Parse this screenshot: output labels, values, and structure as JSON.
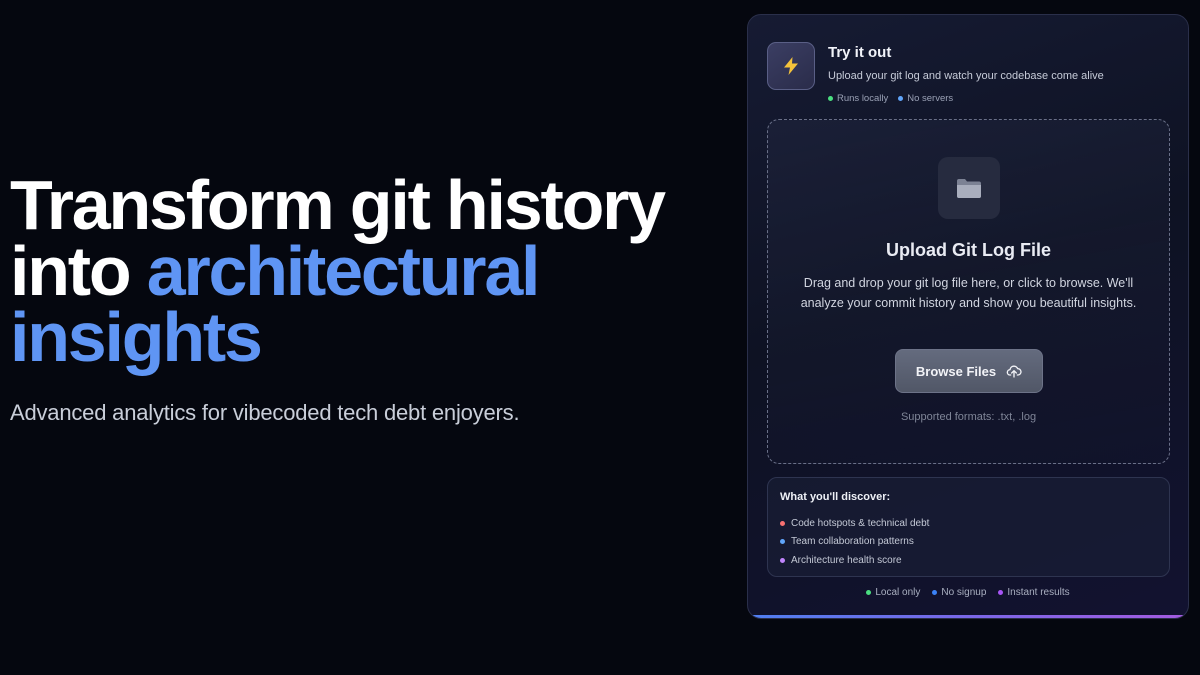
{
  "hero": {
    "title_line1": "Transform git history",
    "title_into": "into ",
    "title_accent_1": "architectural",
    "title_accent_2": "insights",
    "subtitle": "Advanced analytics for vibecoded tech debt enjoyers."
  },
  "card": {
    "icon": "lightning-bolt-icon",
    "title": "Try it out",
    "description": "Upload your git log and watch your codebase come alive",
    "tags": [
      {
        "label": "Runs locally",
        "color": "#4ade80"
      },
      {
        "label": "No servers",
        "color": "#60a5fa"
      }
    ],
    "dropzone": {
      "icon": "folder-icon",
      "title": "Upload Git Log File",
      "description": "Drag and drop your git log file here, or click to browse. We'll analyze your commit history and show you beautiful insights.",
      "button_label": "Browse Files",
      "button_icon": "cloud-upload-icon",
      "formats": "Supported formats: .txt, .log"
    },
    "discover": {
      "title": "What you'll discover:",
      "items": [
        {
          "label": "Code hotspots & technical debt",
          "color": "#f87171"
        },
        {
          "label": "Team collaboration patterns",
          "color": "#60a5fa"
        },
        {
          "label": "Architecture health score",
          "color": "#c084fc"
        }
      ]
    },
    "footer_tags": [
      {
        "label": "Local only",
        "color": "#4ade80"
      },
      {
        "label": "No signup",
        "color": "#3b82f6"
      },
      {
        "label": "Instant results",
        "color": "#a855f7"
      }
    ]
  },
  "colors": {
    "background": "#05070f",
    "accent": "#5f95f4"
  }
}
